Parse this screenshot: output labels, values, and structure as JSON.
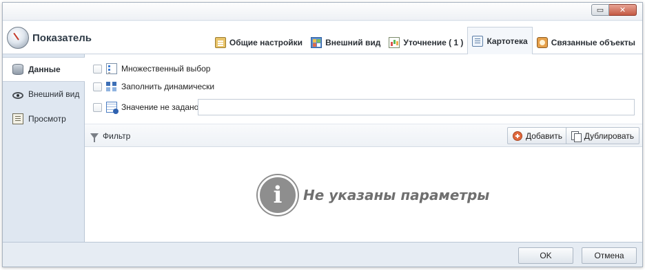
{
  "window": {
    "controls": {
      "restore_icon": "restore-icon",
      "close_icon": "close-icon",
      "close_glyph": "✕",
      "restore_glyph": "▭"
    }
  },
  "header": {
    "title": "Показатель",
    "tabs": [
      {
        "label": "Общие настройки",
        "icon": "settings-icon",
        "active": false
      },
      {
        "label": "Внешний вид",
        "icon": "appearance-icon",
        "active": false
      },
      {
        "label": "Уточнение ( 1 )",
        "icon": "refine-icon",
        "active": false
      },
      {
        "label": "Картотека",
        "icon": "card-index-icon",
        "active": true
      },
      {
        "label": "Связанные объекты",
        "icon": "related-objects-icon",
        "active": false
      }
    ]
  },
  "sidebar": {
    "items": [
      {
        "label": "Данные",
        "icon": "database-icon",
        "active": true
      },
      {
        "label": "Внешний вид",
        "icon": "eye-icon",
        "active": false
      },
      {
        "label": "Просмотр",
        "icon": "preview-icon",
        "active": false
      }
    ]
  },
  "options": {
    "multiple_select": {
      "label": "Множественный выбор",
      "checked": false
    },
    "fill_dynamic": {
      "label": "Заполнить динамически",
      "checked": false
    },
    "value_not_set": {
      "label": "Значение не задано",
      "checked": false,
      "value": ""
    }
  },
  "filterbar": {
    "label": "Фильтр",
    "add_label": "Добавить",
    "duplicate_label": "Дублировать"
  },
  "empty_state": {
    "icon_glyph": "i",
    "message": "Не указаны параметры"
  },
  "footer": {
    "ok_label": "OK",
    "cancel_label": "Отмена"
  }
}
